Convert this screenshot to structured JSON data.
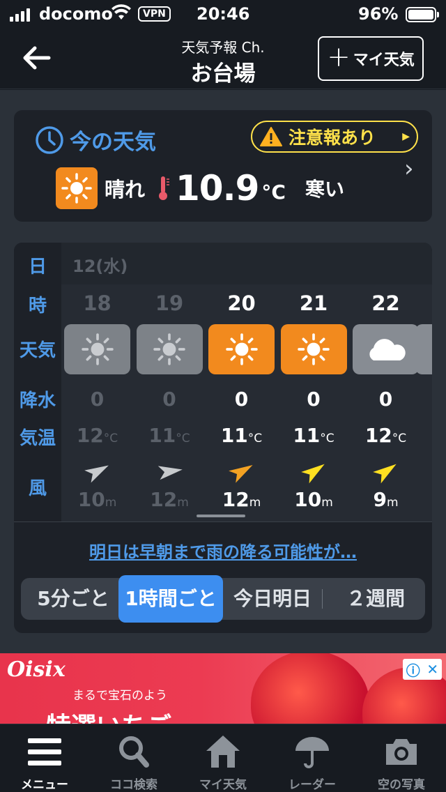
{
  "status_bar": {
    "carrier": "docomo",
    "vpn": "VPN",
    "time": "20:46",
    "battery": "96%"
  },
  "header": {
    "subtitle": "天気予報 Ch.",
    "location": "お台場",
    "my_weather_label": "マイ天気"
  },
  "current": {
    "title": "今の天気",
    "alert": "注意報あり",
    "condition": "晴れ",
    "temperature": "10.9",
    "unit": "°C",
    "feel": "寒い",
    "icon": "sun-icon"
  },
  "forecast": {
    "row_labels": {
      "day": "日",
      "hour": "時",
      "weather": "天気",
      "precip": "降水",
      "temp": "気温",
      "wind": "風"
    },
    "date": "12(水)",
    "hours": [
      {
        "hour": "18",
        "weather": "sunny",
        "precip": "0",
        "temp": "12",
        "temp_unit": "°C",
        "wind_speed": "10",
        "wind_unit": "m",
        "past": true
      },
      {
        "hour": "19",
        "weather": "sunny",
        "precip": "0",
        "temp": "11",
        "temp_unit": "°C",
        "wind_speed": "12",
        "wind_unit": "m",
        "past": true
      },
      {
        "hour": "20",
        "weather": "sunny",
        "precip": "0",
        "temp": "11",
        "temp_unit": "°C",
        "wind_speed": "12",
        "wind_unit": "m",
        "past": false
      },
      {
        "hour": "21",
        "weather": "sunny",
        "precip": "0",
        "temp": "11",
        "temp_unit": "°C",
        "wind_speed": "10",
        "wind_unit": "m",
        "past": false
      },
      {
        "hour": "22",
        "weather": "cloudy",
        "precip": "0",
        "temp": "12",
        "temp_unit": "°C",
        "wind_speed": "9",
        "wind_unit": "m",
        "past": false
      }
    ],
    "note": "明日は早朝まで雨の降る可能性が…",
    "segments": [
      "5分ごと",
      "1時間ごと",
      "今日明日",
      "２週間"
    ],
    "active_segment": "1時間ごと"
  },
  "ad": {
    "brand": "Oisix",
    "copy": "まるで宝石のよう",
    "headline": "特選いちご"
  },
  "tabbar": [
    {
      "label": "メニュー",
      "icon": "menu-icon",
      "active": true
    },
    {
      "label": "ココ検索",
      "icon": "search-icon",
      "active": false
    },
    {
      "label": "マイ天気",
      "icon": "home-icon",
      "active": false
    },
    {
      "label": "レーダー",
      "icon": "umbrella-icon",
      "active": false
    },
    {
      "label": "空の写真",
      "icon": "camera-icon",
      "active": false
    }
  ],
  "colors": {
    "accent_blue": "#4f9ae8",
    "sunny_orange": "#f28a1e",
    "alert_yellow": "#ffe14a",
    "past_gray": "#5b616a"
  }
}
